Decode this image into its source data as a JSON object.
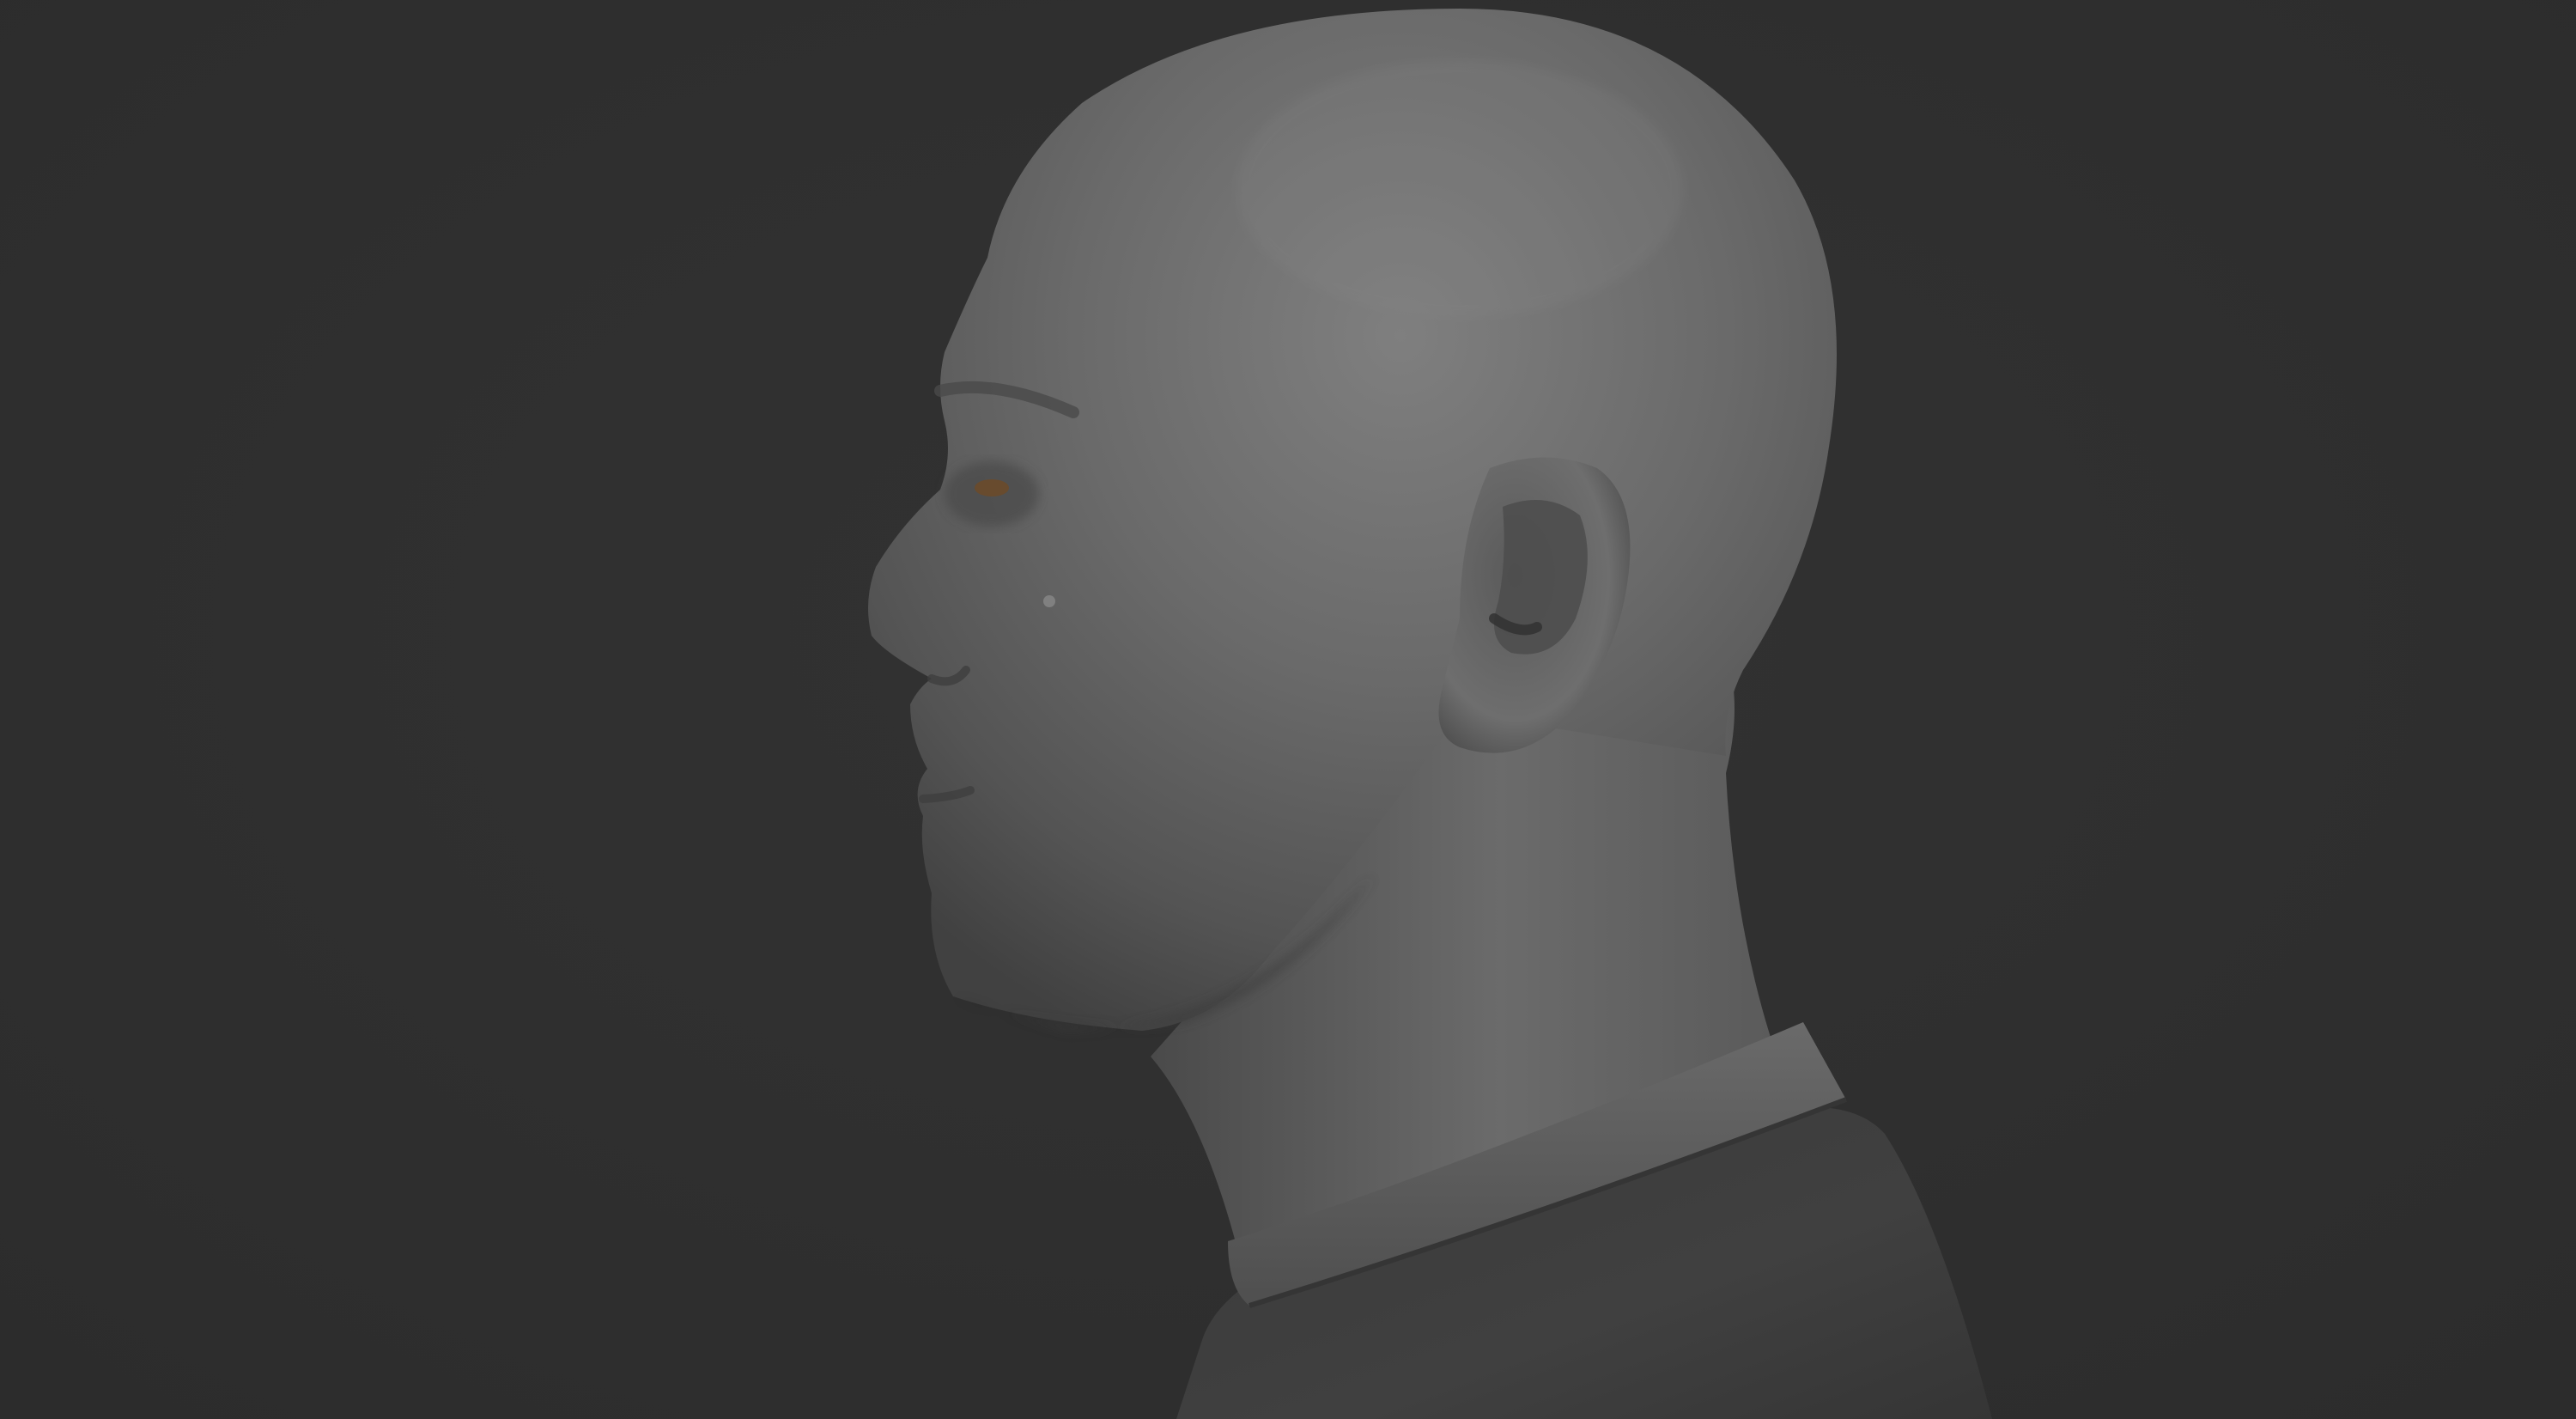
{
  "scene": {
    "background_color": "#2f2f2f",
    "material_color": "#6e6e6e",
    "shirt_color": "#3d3d3d",
    "eye_color": "#6a4a2a"
  }
}
